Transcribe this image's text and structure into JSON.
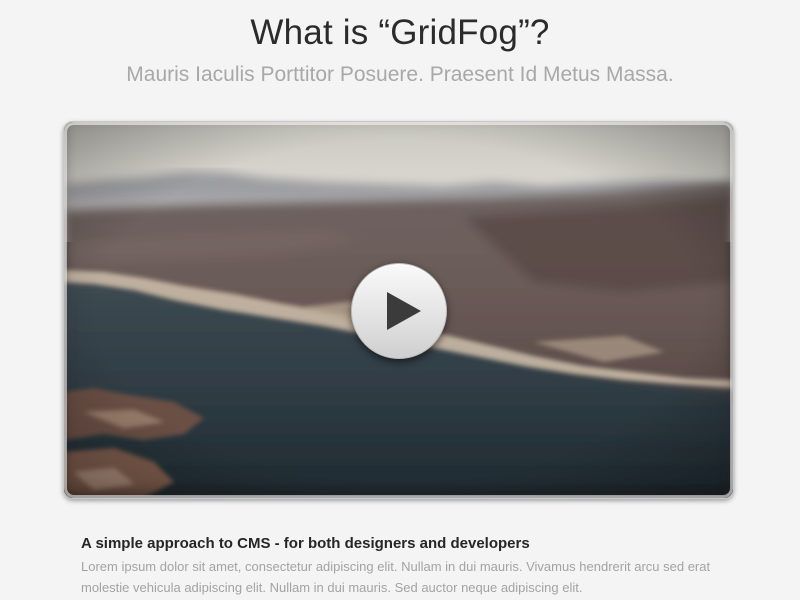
{
  "header": {
    "title": "What is “GridFog”?",
    "subtitle": "Mauris Iaculis Porttitor Posuere. Praesent Id Metus Massa."
  },
  "video": {
    "play_icon": "play-icon",
    "scene": "blurred aerial landscape with lake"
  },
  "feature": {
    "heading": "A simple approach to CMS - for both designers and developers",
    "body": "Lorem ipsum dolor sit amet, consectetur adipiscing elit. Nullam in dui mauris. Vivamus hendrerit arcu sed erat molestie vehicula adipiscing elit. Nullam in dui mauris. Sed auctor neque adipiscing elit."
  },
  "colors": {
    "background": "#f4f4f5",
    "title": "#2b2b2b",
    "subtitle": "#a8a8a8",
    "body_text": "#a3a3a3"
  }
}
